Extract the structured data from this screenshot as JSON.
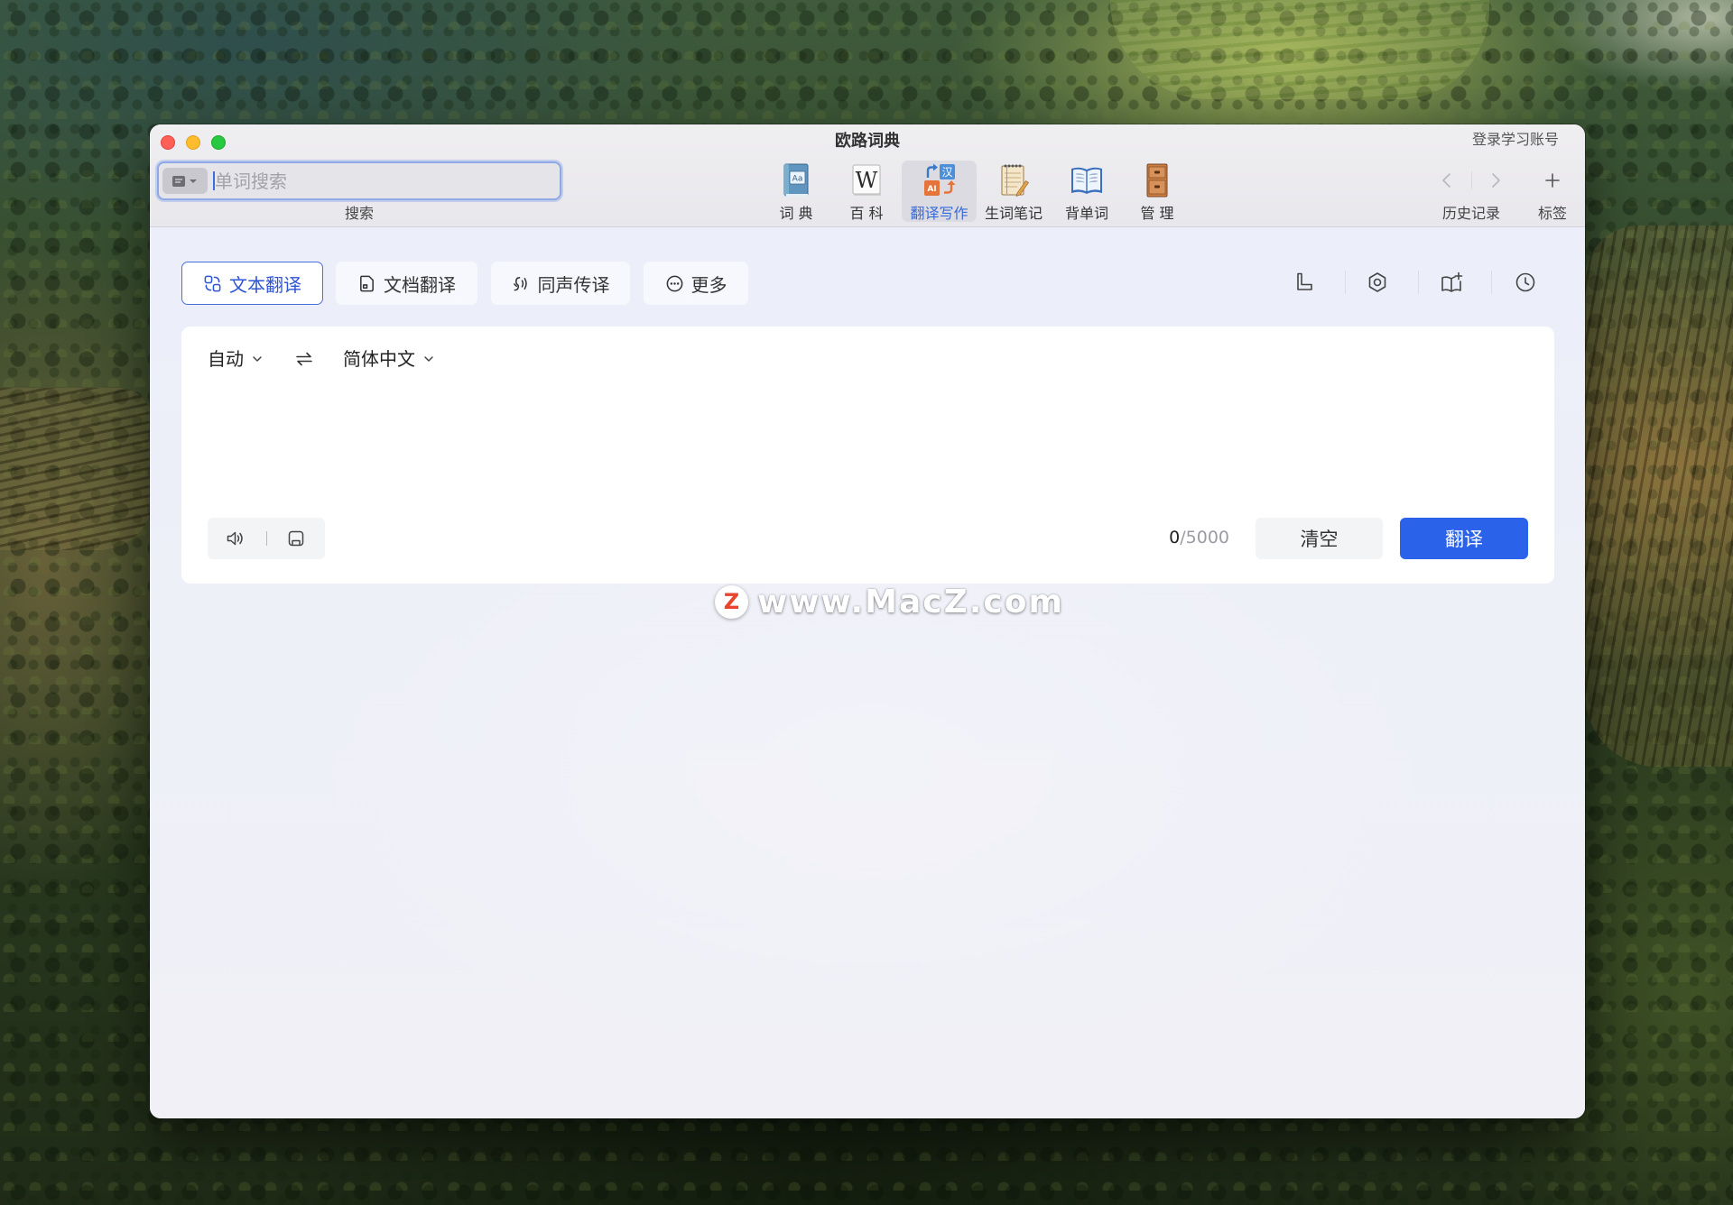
{
  "window": {
    "title": "欧路词典",
    "account_link": "登录学习账号"
  },
  "search": {
    "placeholder": "单词搜索",
    "value": "",
    "label": "搜索",
    "scope_icon": "dictionary-scope-icon"
  },
  "toolbar": {
    "items": [
      {
        "label": "词 典",
        "icon": "dictionary-book-icon",
        "glyph": "Aa",
        "active": false
      },
      {
        "label": "百 科",
        "icon": "wikipedia-icon",
        "glyph": "W",
        "active": false
      },
      {
        "label": "翻译写作",
        "icon": "translate-write-icon",
        "glyph_top": "汉",
        "glyph_bottom": "AI",
        "active": true
      },
      {
        "label": "生词笔记",
        "icon": "notebook-icon",
        "active": false
      },
      {
        "label": "背单词",
        "icon": "open-book-icon",
        "active": false
      },
      {
        "label": "管 理",
        "icon": "cabinet-icon",
        "active": false
      }
    ]
  },
  "nav": {
    "back_icon": "chevron-left-icon",
    "forward_icon": "chevron-right-icon",
    "history_label": "历史记录",
    "add_tag_icon": "plus-icon",
    "tags_label": "标签"
  },
  "tabs": [
    {
      "label": "文本翻译",
      "icon": "text-translate-icon",
      "active": true
    },
    {
      "label": "文档翻译",
      "icon": "document-translate-icon",
      "active": false
    },
    {
      "label": "同声传译",
      "icon": "simultaneous-interpret-icon",
      "active": false
    },
    {
      "label": "更多",
      "icon": "more-icon",
      "active": false
    }
  ],
  "tools": [
    "layout-icon",
    "settings-icon",
    "wordbook-add-icon",
    "history-clock-icon"
  ],
  "translator": {
    "source_lang": "自动",
    "target_lang": "简体中文",
    "input_value": "",
    "char_count": "0",
    "char_limit": "/5000",
    "clear_label": "清空",
    "translate_label": "翻译",
    "speak_icon": "speaker-icon",
    "save_icon": "save-icon",
    "swap_icon": "swap-languages-icon"
  },
  "watermark": {
    "logo_letter": "Z",
    "text": "www.MacZ.com"
  },
  "colors": {
    "accent": "#2a62ea",
    "active_tab": "#2f55d4",
    "active_tool": "#3a6ad6",
    "content_bg": "#eef0f8",
    "card_bg": "#ffffff",
    "close": "#fe5f57",
    "minimize": "#febc2e",
    "zoom": "#28c840"
  }
}
